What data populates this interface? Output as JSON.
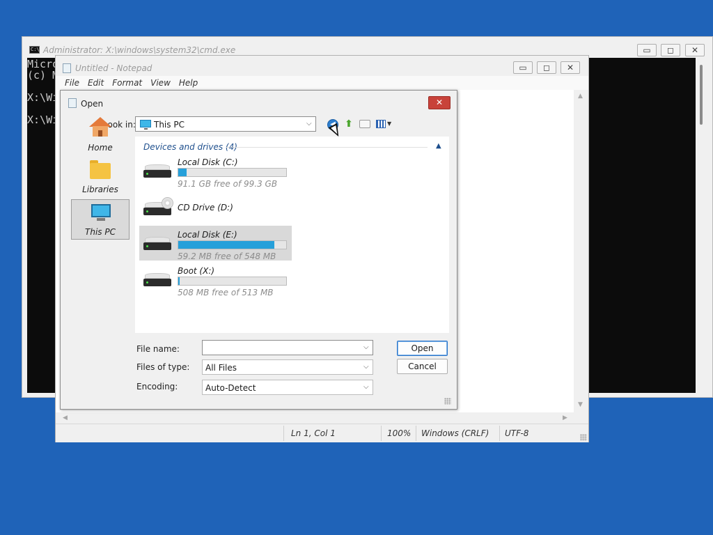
{
  "cmd": {
    "title": "Administrator: X:\\windows\\system32\\cmd.exe",
    "icon_text": "C:\\",
    "lines": [
      "Micro",
      "(c) M",
      "",
      "X:\\Wi",
      "",
      "X:\\Wi"
    ]
  },
  "notepad": {
    "title": "Untitled - Notepad",
    "menu": [
      "File",
      "Edit",
      "Format",
      "View",
      "Help"
    ],
    "status": {
      "position": "Ln 1, Col 1",
      "zoom": "100%",
      "line_ending": "Windows (CRLF)",
      "encoding": "UTF-8"
    }
  },
  "window_controls": {
    "minimize": "▭",
    "maximize": "◻",
    "close": "✕"
  },
  "dialog": {
    "title": "Open",
    "close": "✕",
    "look_in_label": "Look in:",
    "look_in_value": "This PC",
    "places": [
      "Home",
      "Libraries",
      "This PC"
    ],
    "group_header": "Devices and drives (4)",
    "drives": [
      {
        "name": "Local Disk (C:)",
        "free_text": "91.1 GB free of 99.3 GB",
        "used_fraction": 0.08,
        "type": "hdd"
      },
      {
        "name": "CD Drive (D:)",
        "free_text": "",
        "used_fraction": null,
        "type": "cd"
      },
      {
        "name": "Local Disk (E:)",
        "free_text": "59.2 MB free of 548 MB",
        "used_fraction": 0.89,
        "type": "hdd",
        "selected": true
      },
      {
        "name": "Boot (X:)",
        "free_text": "508 MB free of 513 MB",
        "used_fraction": 0.01,
        "type": "hdd"
      }
    ],
    "file_name_label": "File name:",
    "file_name_value": "",
    "files_of_type_label": "Files of type:",
    "files_of_type_value": "All Files",
    "encoding_label": "Encoding:",
    "encoding_value": "Auto-Detect",
    "open_label": "Open",
    "cancel_label": "Cancel"
  },
  "colors": {
    "desktop": "#1f63b8",
    "close_red": "#c8423a",
    "progress": "#26a0da",
    "selection": "#d9d9d9"
  }
}
